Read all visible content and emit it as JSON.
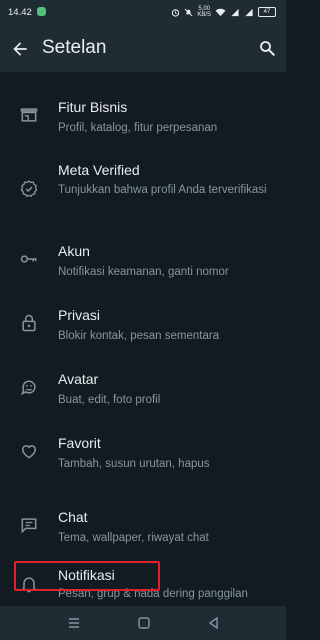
{
  "status_bar": {
    "time": "14.42",
    "net_speed_top": "5,00",
    "net_speed_bottom": "KB/S",
    "battery": "47"
  },
  "app_bar": {
    "title": "Setelan"
  },
  "settings": [
    {
      "icon": "storefront-icon",
      "name": "Fitur Bisnis",
      "sub": "Profil, katalog, fitur perpesanan"
    },
    {
      "icon": "verified-badge-icon",
      "name": "Meta Verified",
      "sub": "Tunjukkan bahwa profil Anda terverifikasi"
    },
    {
      "icon": "key-icon",
      "name": "Akun",
      "sub": "Notifikasi keamanan, ganti nomor"
    },
    {
      "icon": "lock-icon",
      "name": "Privasi",
      "sub": "Blokir kontak, pesan sementara"
    },
    {
      "icon": "avatar-face-icon",
      "name": "Avatar",
      "sub": "Buat, edit, foto profil"
    },
    {
      "icon": "heart-icon",
      "name": "Favorit",
      "sub": "Tambah, susun urutan, hapus"
    },
    {
      "icon": "chat-icon",
      "name": "Chat",
      "sub": "Tema, wallpaper, riwayat chat"
    },
    {
      "icon": "bell-icon",
      "name": "Notifikasi",
      "sub": "Pesan, grup & nada dering panggilan"
    }
  ],
  "colors": {
    "background": "#121b22",
    "app_bar": "#1f2c34",
    "primary_text": "#e9edef",
    "secondary_text": "#8696a0",
    "highlight_box": "#e0202a"
  }
}
